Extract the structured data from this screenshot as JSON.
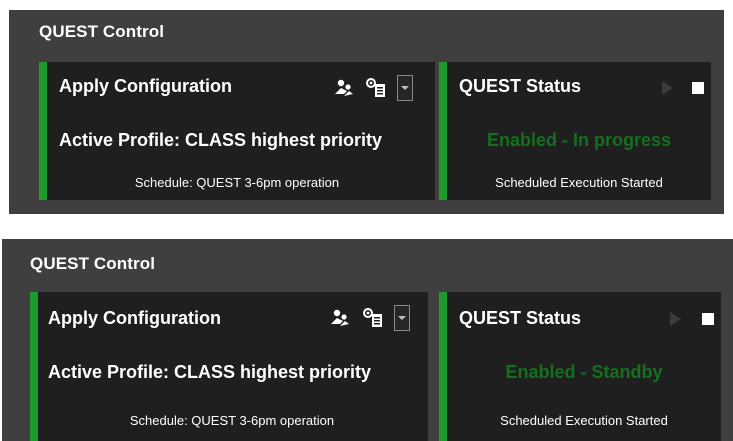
{
  "panels": [
    {
      "title": "QUEST Control",
      "apply": {
        "title": "Apply Configuration",
        "profile": "Active Profile: CLASS highest priority",
        "schedule": "Schedule: QUEST 3-6pm operation"
      },
      "status": {
        "title": "QUEST Status",
        "state": "Enabled - In progress",
        "info": "Scheduled Execution Started"
      }
    },
    {
      "title": "QUEST Control",
      "apply": {
        "title": "Apply Configuration",
        "profile": "Active Profile: CLASS highest priority",
        "schedule": "Schedule: QUEST 3-6pm operation"
      },
      "status": {
        "title": "QUEST Status",
        "state": "Enabled - Standby",
        "info": "Scheduled Execution Started"
      }
    }
  ],
  "icons": {
    "apply_icon_1": "users-icon",
    "apply_icon_2": "config-icon",
    "apply_dropdown": "chevron-down-icon",
    "status_play": "play-icon",
    "status_stop": "stop-icon"
  },
  "colors": {
    "panel_bg": "#3f3f3f",
    "card_bg": "#1f1f1f",
    "accent_green": "#1f9a2e",
    "status_text_green": "#13701d"
  }
}
